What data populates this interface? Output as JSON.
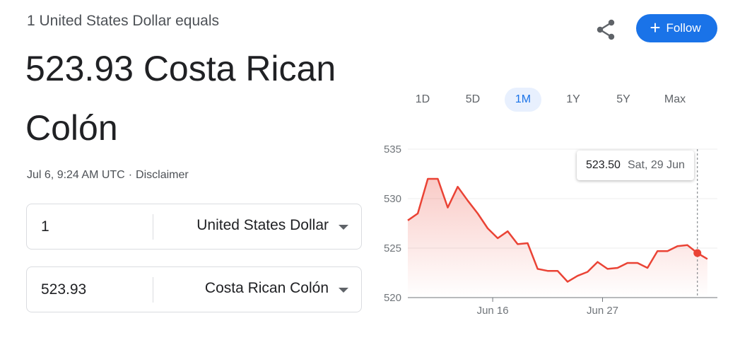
{
  "header": {
    "subtitle": "1 United States Dollar equals",
    "rate_line1": "523.93 Costa Rican",
    "rate_line2": "Colón",
    "timestamp": "Jul 6, 9:24 AM UTC",
    "separator": "·",
    "disclaimer": "Disclaimer"
  },
  "actions": {
    "share_icon": "share-icon",
    "follow_label": "Follow",
    "follow_icon": "+",
    "follow_color": "#1a73e8"
  },
  "converter": {
    "from": {
      "amount": "1",
      "currency": "United States Dollar"
    },
    "to": {
      "amount": "523.93",
      "currency": "Costa Rican Colón"
    }
  },
  "ranges": {
    "options": [
      "1D",
      "5D",
      "1M",
      "1Y",
      "5Y",
      "Max"
    ],
    "selected": "1M"
  },
  "tooltip": {
    "value": "523.50",
    "date": "Sat, 29 Jun"
  },
  "chart_data": {
    "type": "line",
    "series_color": "#ea4335",
    "ylim": [
      520,
      535
    ],
    "y_ticks": [
      "520",
      "525",
      "530",
      "535"
    ],
    "x_ticks": [
      {
        "label": "Jun 16",
        "x": 8.5
      },
      {
        "label": "Jun 27",
        "x": 19.5
      }
    ],
    "xlim": [
      0,
      31
    ],
    "highlight_index": 29,
    "points": [
      [
        0,
        527.8
      ],
      [
        1,
        528.5
      ],
      [
        2,
        532.0
      ],
      [
        3,
        532.0
      ],
      [
        4,
        529.1
      ],
      [
        5,
        531.2
      ],
      [
        6,
        529.8
      ],
      [
        7,
        528.5
      ],
      [
        8,
        527.0
      ],
      [
        9,
        526.0
      ],
      [
        10,
        526.7
      ],
      [
        11,
        525.4
      ],
      [
        12,
        525.5
      ],
      [
        13,
        522.9
      ],
      [
        14,
        522.7
      ],
      [
        15,
        522.7
      ],
      [
        16,
        521.6
      ],
      [
        17,
        522.2
      ],
      [
        18,
        522.6
      ],
      [
        19,
        523.6
      ],
      [
        20,
        522.9
      ],
      [
        21,
        523.0
      ],
      [
        22,
        523.5
      ],
      [
        23,
        523.5
      ],
      [
        24,
        523.0
      ],
      [
        25,
        524.7
      ],
      [
        26,
        524.7
      ],
      [
        27,
        525.2
      ],
      [
        28,
        525.3
      ],
      [
        29,
        524.5
      ],
      [
        30,
        523.9
      ]
    ]
  }
}
